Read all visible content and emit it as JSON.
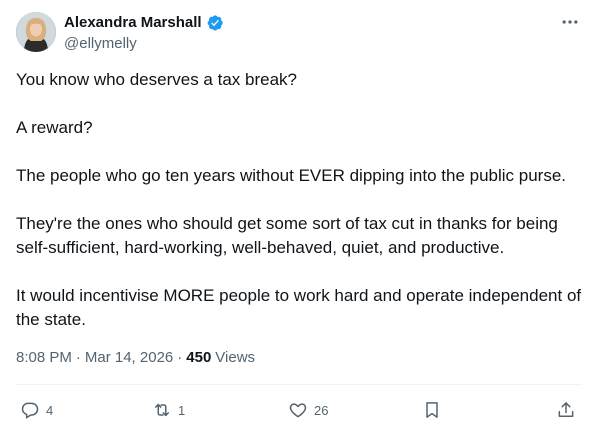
{
  "author": {
    "display_name": "Alexandra Marshall",
    "handle": "@ellymelly",
    "verified": true,
    "verified_color": "#1d9bf0"
  },
  "tweet": {
    "paragraphs": [
      "You know who deserves a tax break?",
      "A reward?",
      "The people who go ten years without EVER dipping into the public purse.",
      "They're the ones who should get some sort of tax cut in thanks for being self-sufficient, hard-working, well-behaved, quiet, and productive.",
      "It would incentivise MORE people to work hard and operate independent of the state."
    ],
    "time": "8:08 PM",
    "separator": "·",
    "date": "Mar 14, 2026",
    "views_count": "450",
    "views_label": "Views"
  },
  "actions": {
    "replies": "4",
    "reposts": "1",
    "likes": "26",
    "bookmark_icon": "bookmark-icon",
    "share_icon": "share-icon"
  },
  "icons": {
    "more": "more-horizontal-icon",
    "reply": "reply-icon",
    "repost": "repost-icon",
    "like": "heart-icon"
  }
}
